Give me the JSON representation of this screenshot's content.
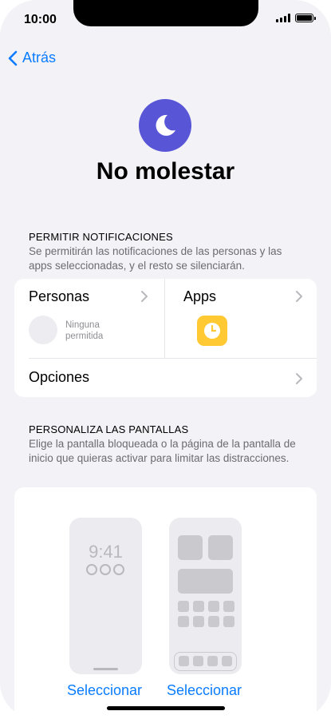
{
  "status_bar": {
    "time": "10:00",
    "battery_level": 1.0
  },
  "nav": {
    "back_label": "Atrás"
  },
  "header": {
    "title": "No molestar",
    "icon": "moon-icon",
    "icon_color": "#5856d6"
  },
  "notifications": {
    "heading": "PERMITIR NOTIFICACIONES",
    "description": "Se permitirán las notificaciones de las personas y las apps seleccionadas, y el resto se silenciarán.",
    "people_label": "Personas",
    "people_status_line1": "Ninguna",
    "people_status_line2": "permitida",
    "apps_label": "Apps",
    "app_icon": "clock-app-icon",
    "options_label": "Opciones"
  },
  "customize": {
    "heading": "PERSONALIZA LAS PANTALLAS",
    "description": "Elige la pantalla bloqueada o la página de la pantalla de inicio que quieras activar para limitar las distracciones.",
    "lock_preview_time": "9:41",
    "select_lock_label": "Seleccionar",
    "select_home_label": "Seleccionar"
  },
  "colors": {
    "accent": "#0a7cff",
    "background": "#f2f2f7",
    "app_icon_bg": "#ffc933"
  }
}
